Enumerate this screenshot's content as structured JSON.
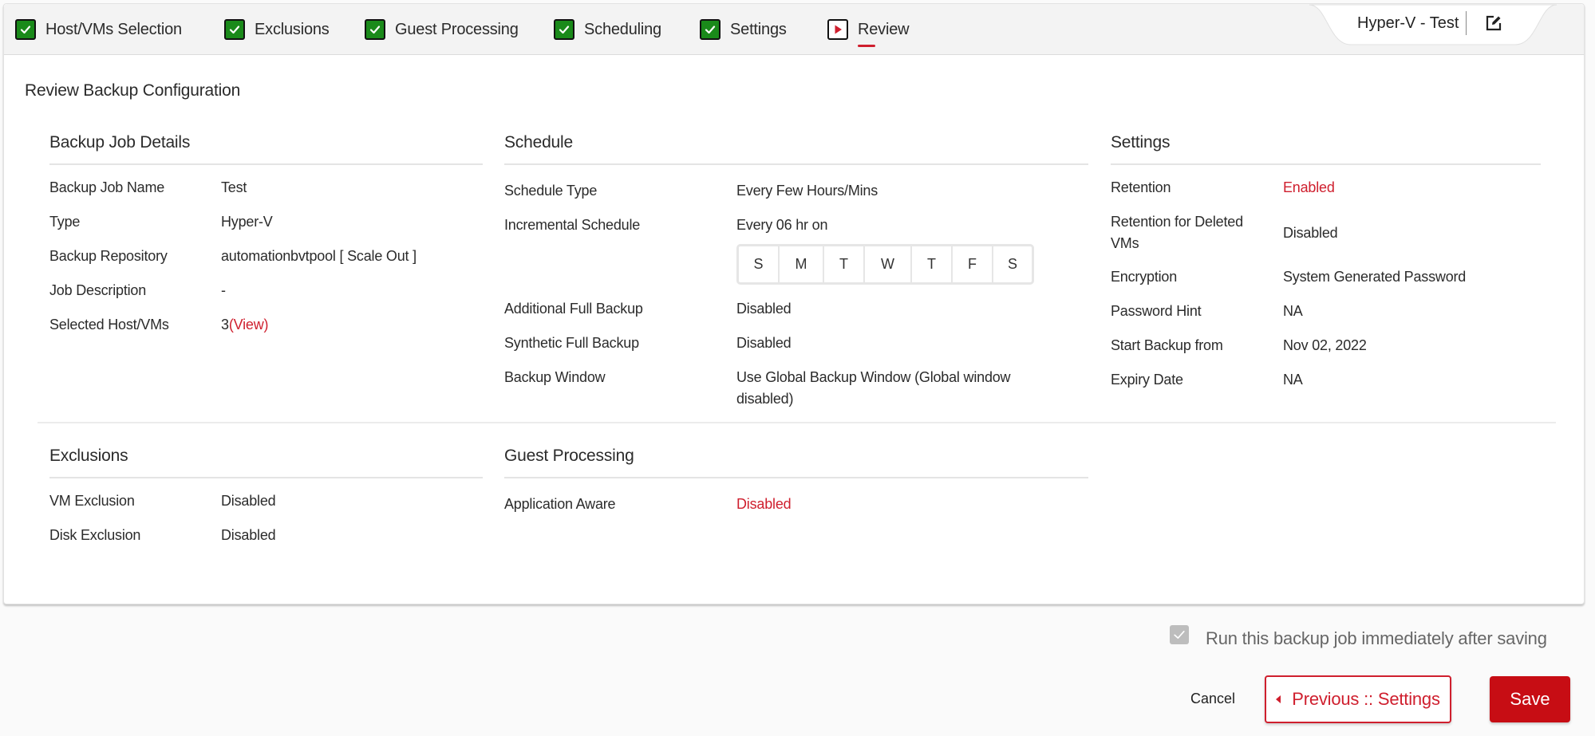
{
  "wizard": {
    "steps": [
      {
        "label": "Host/VMs Selection",
        "status": "completed",
        "icon": "check-icon"
      },
      {
        "label": "Exclusions",
        "status": "completed",
        "icon": "check-icon"
      },
      {
        "label": "Guest Processing",
        "status": "completed",
        "icon": "check-icon"
      },
      {
        "label": "Scheduling",
        "status": "completed",
        "icon": "check-icon"
      },
      {
        "label": "Settings",
        "status": "completed",
        "icon": "check-icon"
      },
      {
        "label": "Review",
        "status": "current",
        "icon": "play-icon"
      }
    ],
    "job_name": "Hyper-V - Test",
    "edit_icon": "edit-icon"
  },
  "page_title": "Review Backup Configuration",
  "backup_job_details": {
    "title": "Backup Job Details",
    "rows": [
      {
        "key": "Backup Job Name",
        "value": "Test"
      },
      {
        "key": "Type",
        "value": "Hyper-V"
      },
      {
        "key": "Backup Repository",
        "value": "automationbvtpool [ Scale Out ]"
      },
      {
        "key": "Job Description",
        "value": "-"
      },
      {
        "key": "Selected Host/VMs",
        "value": "3",
        "link": "(View)"
      }
    ]
  },
  "schedule": {
    "title": "Schedule",
    "rows": [
      {
        "key": "Schedule Type",
        "value": "Every Few Hours/Mins"
      },
      {
        "key": "Incremental Schedule",
        "value": "Every 06 hr on"
      },
      {
        "key": "Additional Full Backup",
        "value": "Disabled"
      },
      {
        "key": "Synthetic Full Backup",
        "value": "Disabled"
      },
      {
        "key": "Backup Window",
        "value": "Use Global Backup Window  (Global window",
        "value_line2": "disabled)"
      }
    ],
    "days": [
      "S",
      "M",
      "T",
      "W",
      "T",
      "F",
      "S"
    ]
  },
  "settings": {
    "title": "Settings",
    "rows": [
      {
        "key": "Retention",
        "value": "Enabled",
        "highlight": true
      },
      {
        "key": "Retention for Deleted",
        "key_line2": "VMs",
        "value": "Disabled"
      },
      {
        "key": "Encryption",
        "value": "System Generated Password"
      },
      {
        "key": "Password Hint",
        "value": "NA"
      },
      {
        "key": "Start Backup from",
        "value": "Nov 02, 2022"
      },
      {
        "key": "Expiry Date",
        "value": "NA"
      }
    ]
  },
  "exclusions": {
    "title": "Exclusions",
    "rows": [
      {
        "key": "VM Exclusion",
        "value": "Disabled"
      },
      {
        "key": "Disk Exclusion",
        "value": "Disabled"
      }
    ]
  },
  "guest_processing": {
    "title": "Guest Processing",
    "rows": [
      {
        "key": "Application Aware",
        "value": "Disabled",
        "highlight": true
      }
    ]
  },
  "footer": {
    "run_immediately_label": "Run this backup job immediately after saving",
    "run_immediately_checked": true,
    "cancel_label": "Cancel",
    "previous_label": "Previous :: Settings",
    "save_label": "Save"
  },
  "colors": {
    "accent": "#cf1f2e",
    "save_button": "#c70d14",
    "completed_step": "#1a8a1a"
  }
}
